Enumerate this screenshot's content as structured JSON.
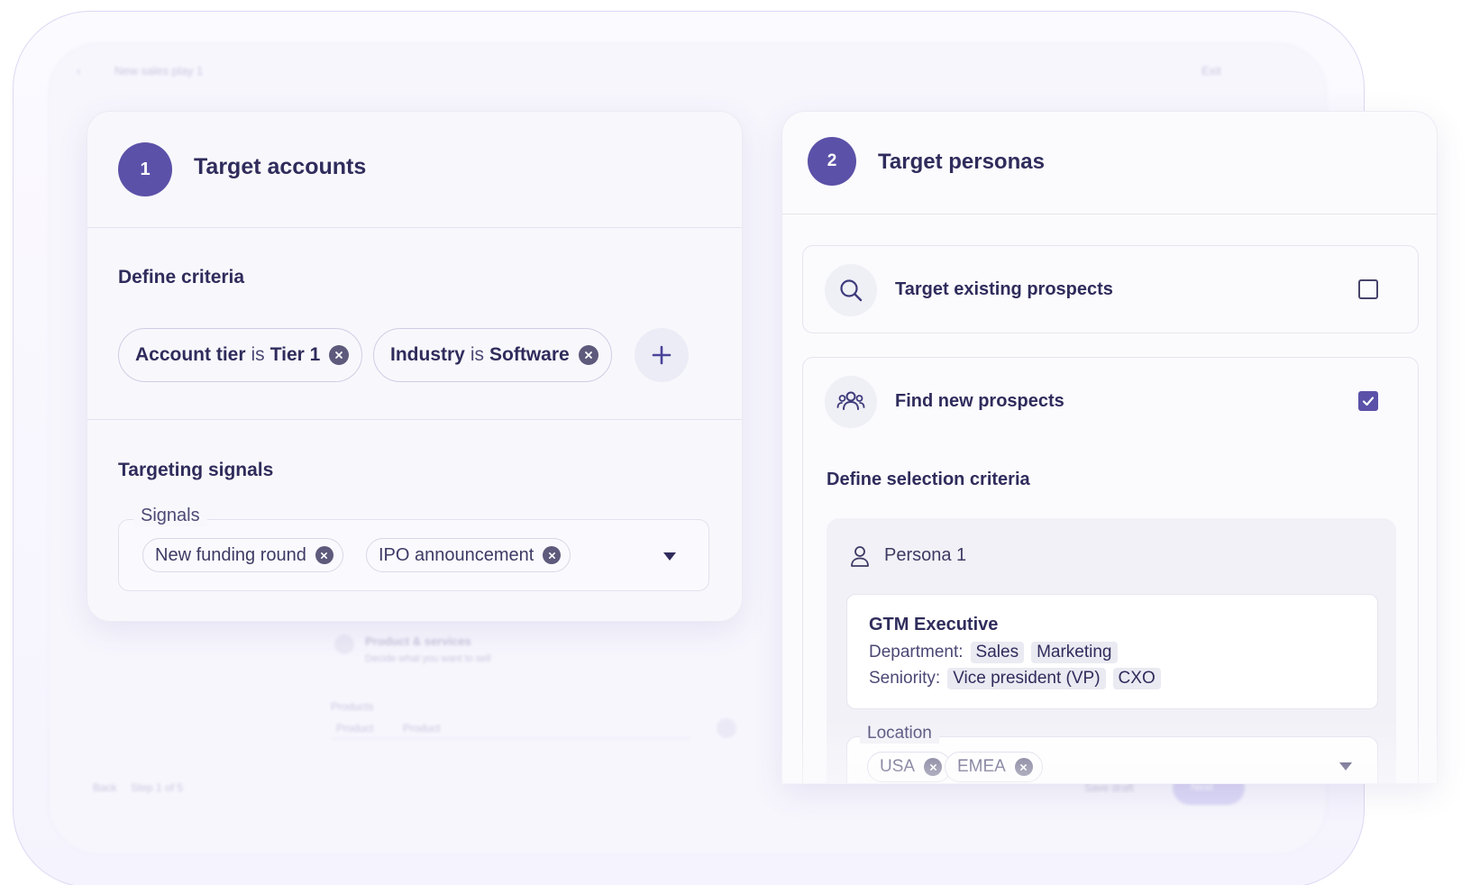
{
  "background": {
    "title": "New sales play 1",
    "exit": "Exit",
    "step_counter": "Step 1 of 5",
    "back": "Back",
    "save_draft": "Save draft",
    "next": "Next",
    "section": "Product & services",
    "section_sub": "Decide what you want to sell",
    "products_label": "Products",
    "product_chips": [
      "Product",
      "Product"
    ]
  },
  "accounts_card": {
    "step_number": "1",
    "title": "Target accounts",
    "criteria_label": "Define criteria",
    "criteria": [
      {
        "field": "Account tier",
        "operator": "is",
        "value": "Tier 1"
      },
      {
        "field": "Industry",
        "operator": "is",
        "value": "Software"
      }
    ],
    "signals_section_label": "Targeting signals",
    "signals_field_label": "Signals",
    "signals": [
      "New funding round",
      "IPO announcement"
    ]
  },
  "personas_card": {
    "step_number": "2",
    "title": "Target personas",
    "options": [
      {
        "label": "Target existing prospects",
        "checked": false,
        "icon": "search-icon"
      },
      {
        "label": "Find new prospects",
        "checked": true,
        "icon": "users-icon"
      }
    ],
    "selection_label": "Define selection criteria",
    "persona": {
      "title": "Persona 1",
      "name": "GTM Executive",
      "department_label": "Department:",
      "departments": [
        "Sales",
        "Marketing"
      ],
      "seniority_label": "Seniority:",
      "seniorities": [
        "Vice president (VP)",
        "CXO"
      ]
    },
    "location_label": "Location",
    "locations": [
      "USA",
      "EMEA"
    ]
  },
  "colors": {
    "accent": "#5b51a8",
    "text": "#2f2c5c",
    "chip_border": "#cfcde4"
  }
}
